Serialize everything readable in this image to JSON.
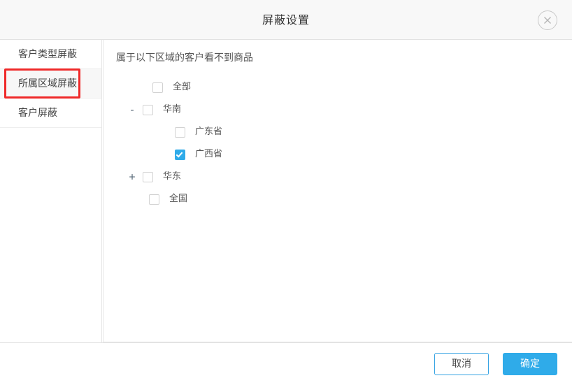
{
  "dialog": {
    "title": "屏蔽设置",
    "close_icon": "close-circle-icon"
  },
  "sidebar": {
    "items": [
      {
        "label": "客户类型屏蔽",
        "active": false,
        "highlighted": false
      },
      {
        "label": "所属区域屏蔽",
        "active": true,
        "highlighted": true
      },
      {
        "label": "客户屏蔽",
        "active": false,
        "highlighted": false
      }
    ]
  },
  "content": {
    "description": "属于以下区域的客户看不到商品",
    "tree": [
      {
        "label": "全部",
        "checked": false,
        "expander": "",
        "level": "root"
      },
      {
        "label": "华南",
        "checked": false,
        "expander": "-",
        "level": "root-x"
      },
      {
        "label": "广东省",
        "checked": false,
        "expander": "",
        "level": "child"
      },
      {
        "label": "广西省",
        "checked": true,
        "expander": "",
        "level": "child"
      },
      {
        "label": "华东",
        "checked": false,
        "expander": "+",
        "level": "root-x"
      },
      {
        "label": "全国",
        "checked": false,
        "expander": "",
        "level": "last"
      }
    ]
  },
  "footer": {
    "cancel_label": "取消",
    "confirm_label": "确定"
  },
  "colors": {
    "accent": "#2fabe9",
    "cancel_border": "#36a3e3",
    "highlight": "#ef2929",
    "header_bg": "#f8f8f8",
    "active_item_bg": "#f7f7f7"
  }
}
